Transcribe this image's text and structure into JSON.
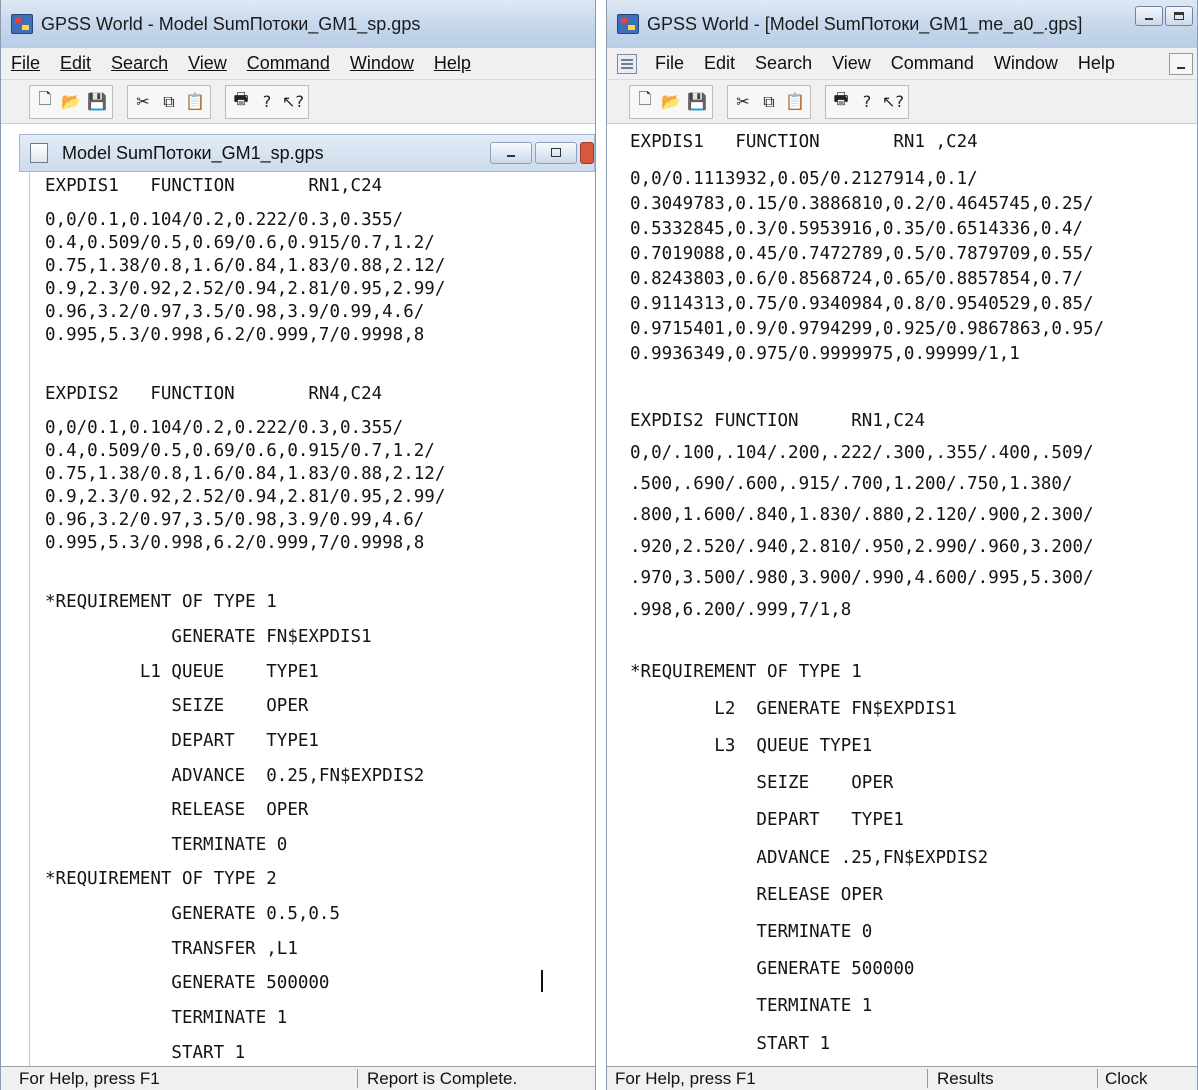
{
  "left_window": {
    "title": "GPSS World - Model SumПотоки_GM1_sp.gps",
    "menu": [
      "File",
      "Edit",
      "Search",
      "View",
      "Command",
      "Window",
      "Help"
    ],
    "toolbar_icons": [
      "new-icon",
      "open-icon",
      "save-icon",
      "cut-icon",
      "copy-icon",
      "paste-icon",
      "print-icon",
      "help-icon",
      "context-help-icon"
    ],
    "doc_title": "Model SumПотоки_GM1_sp.gps",
    "code": [
      "EXPDIS1   FUNCTION       RN1,C24",
      "0,0/0.1,0.104/0.2,0.222/0.3,0.355/",
      "0.4,0.509/0.5,0.69/0.6,0.915/0.7,1.2/",
      "0.75,1.38/0.8,1.6/0.84,1.83/0.88,2.12/",
      "0.9,2.3/0.92,2.52/0.94,2.81/0.95,2.99/",
      "0.96,3.2/0.97,3.5/0.98,3.9/0.99,4.6/",
      "0.995,5.3/0.998,6.2/0.999,7/0.9998,8",
      "EXPDIS2   FUNCTION       RN4,C24",
      "0,0/0.1,0.104/0.2,0.222/0.3,0.355/",
      "0.4,0.509/0.5,0.69/0.6,0.915/0.7,1.2/",
      "0.75,1.38/0.8,1.6/0.84,1.83/0.88,2.12/",
      "0.9,2.3/0.92,2.52/0.94,2.81/0.95,2.99/",
      "0.96,3.2/0.97,3.5/0.98,3.9/0.99,4.6/",
      "0.995,5.3/0.998,6.2/0.999,7/0.9998,8",
      "*REQUIREMENT OF TYPE 1",
      "            GENERATE FN$EXPDIS1",
      "         L1 QUEUE    TYPE1",
      "            SEIZE    OPER",
      "            DEPART   TYPE1",
      "            ADVANCE  0.25,FN$EXPDIS2",
      "            RELEASE  OPER",
      "            TERMINATE 0",
      "*REQUIREMENT OF TYPE 2",
      "            GENERATE 0.5,0.5",
      "            TRANSFER ,L1",
      "            GENERATE 500000",
      "            TERMINATE 1",
      "            START 1"
    ],
    "status": {
      "help": "For Help, press F1",
      "report": "Report is Complete."
    }
  },
  "right_window": {
    "title": "GPSS World - [Model SumПотоки_GM1_me_a0_.gps]",
    "menu": [
      "File",
      "Edit",
      "Search",
      "View",
      "Command",
      "Window",
      "Help"
    ],
    "toolbar_icons": [
      "new-icon",
      "open-icon",
      "save-icon",
      "cut-icon",
      "copy-icon",
      "paste-icon",
      "print-icon",
      "help-icon",
      "context-help-icon"
    ],
    "code": [
      "EXPDIS1   FUNCTION       RN1 ,C24",
      "0,0/0.1113932,0.05/0.2127914,0.1/",
      "0.3049783,0.15/0.3886810,0.2/0.4645745,0.25/",
      "0.5332845,0.3/0.5953916,0.35/0.6514336,0.4/",
      "0.7019088,0.45/0.7472789,0.5/0.7879709,0.55/",
      "0.8243803,0.6/0.8568724,0.65/0.8857854,0.7/",
      "0.9114313,0.75/0.9340984,0.8/0.9540529,0.85/",
      "0.9715401,0.9/0.9794299,0.925/0.9867863,0.95/",
      "0.9936349,0.975/0.9999975,0.99999/1,1",
      "EXPDIS2 FUNCTION     RN1,C24",
      "0,0/.100,.104/.200,.222/.300,.355/.400,.509/",
      ".500,.690/.600,.915/.700,1.200/.750,1.380/",
      ".800,1.600/.840,1.830/.880,2.120/.900,2.300/",
      ".920,2.520/.940,2.810/.950,2.990/.960,3.200/",
      ".970,3.500/.980,3.900/.990,4.600/.995,5.300/",
      ".998,6.200/.999,7/1,8",
      "*REQUIREMENT OF TYPE 1",
      "        L2  GENERATE FN$EXPDIS1",
      "        L3  QUEUE TYPE1",
      "            SEIZE    OPER",
      "            DEPART   TYPE1",
      "            ADVANCE .25,FN$EXPDIS2",
      "            RELEASE OPER",
      "            TERMINATE 0",
      "            GENERATE 500000",
      "            TERMINATE 1",
      "            START 1"
    ],
    "status": {
      "help": "For Help, press F1",
      "results": "Results",
      "clock": "Clock"
    }
  }
}
